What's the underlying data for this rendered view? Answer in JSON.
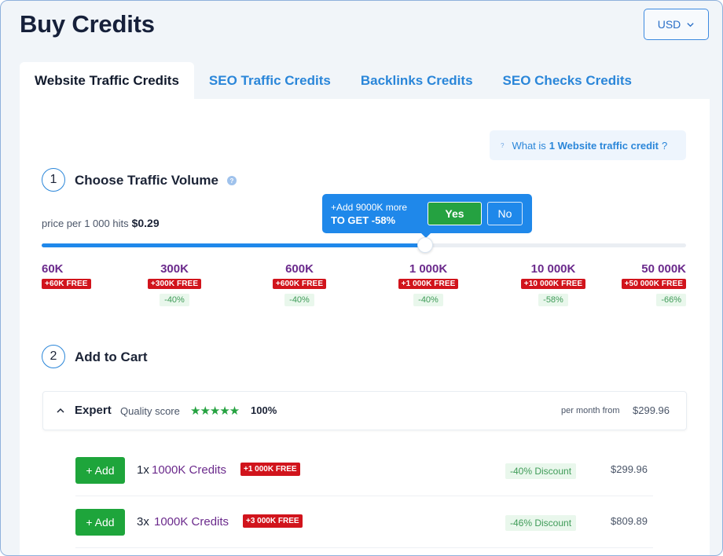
{
  "page": {
    "title": "Buy Credits"
  },
  "currency": {
    "value": "USD"
  },
  "tabs": [
    {
      "label": "Website Traffic Credits",
      "active": true
    },
    {
      "label": "SEO Traffic Credits",
      "active": false
    },
    {
      "label": "Backlinks Credits",
      "active": false
    },
    {
      "label": "SEO Checks Credits",
      "active": false
    }
  ],
  "info": {
    "prefix": "What is",
    "highlight": "1 Website traffic credit",
    "suffix": "?"
  },
  "step1": {
    "number": "1",
    "title": "Choose Traffic Volume"
  },
  "price_per": {
    "label": "price per 1 000 hits",
    "value": "$0.29"
  },
  "popover": {
    "line1": "+Add 9000K more",
    "line2": "TO GET -58%",
    "yes": "Yes",
    "no": "No"
  },
  "slider": {
    "fill_fraction": 0.595
  },
  "ticks": [
    {
      "label": "60K",
      "free": "+60K FREE",
      "discount": ""
    },
    {
      "label": "300K",
      "free": "+300K FREE",
      "discount": "-40%"
    },
    {
      "label": "600K",
      "free": "+600K FREE",
      "discount": "-40%"
    },
    {
      "label": "1 000K",
      "free": "+1 000K FREE",
      "discount": "-40%"
    },
    {
      "label": "10 000K",
      "free": "+10 000K FREE",
      "discount": "-58%"
    },
    {
      "label": "50 000K",
      "free": "+50 000K FREE",
      "discount": "-66%"
    }
  ],
  "step2": {
    "number": "2",
    "title": "Add to Cart"
  },
  "plan": {
    "name": "Expert",
    "quality_label": "Quality score",
    "stars": "★★★★★",
    "rating": 5,
    "quality_pct": "100%",
    "per_month_label": "per month from",
    "price": "$299.96"
  },
  "rows": [
    {
      "add": "+ Add",
      "qty": "1x",
      "credits": "1000K Credits",
      "free": "+1 000K FREE",
      "discount": "-40% Discount",
      "price": "$299.96"
    },
    {
      "add": "+ Add",
      "qty": "3x",
      "credits": "1000K Credits",
      "free": "+3 000K FREE",
      "discount": "-46% Discount",
      "price": "$809.89"
    }
  ],
  "colors": {
    "accent": "#1f88ea",
    "tab_text": "#2a86d9",
    "purple": "#6b2a8c",
    "free_badge": "#d1141c",
    "success": "#1ea53b",
    "discount_bg": "#e9f7ec",
    "discount_text": "#3f9b58"
  }
}
